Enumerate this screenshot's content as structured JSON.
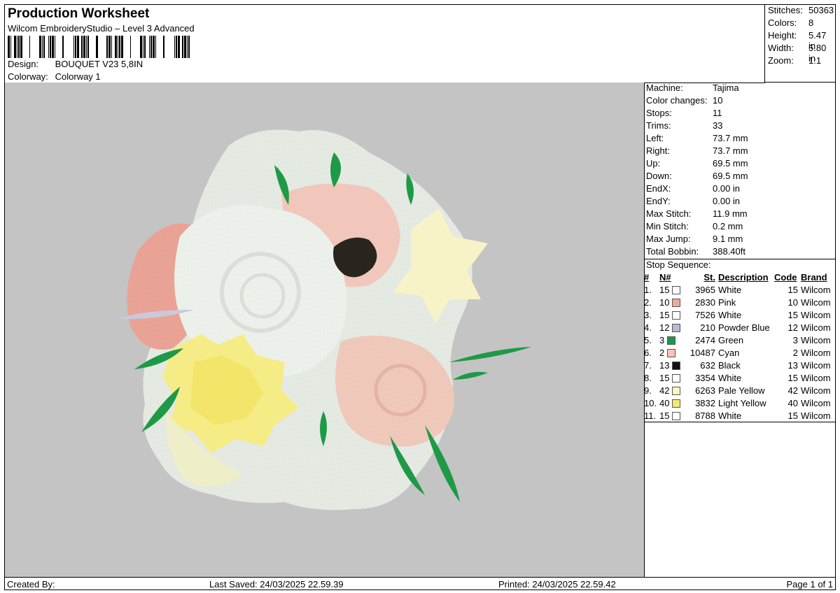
{
  "header": {
    "title": "Production Worksheet",
    "subtitle": "Wilcom EmbroideryStudio – Level 3 Advanced",
    "design_label": "Design:",
    "design_value": "BOUQUET V23 5,8IN",
    "colorway_label": "Colorway:",
    "colorway_value": "Colorway 1"
  },
  "summary": [
    {
      "label": "Stitches:",
      "value": "50363"
    },
    {
      "label": "Colors:",
      "value": "8"
    },
    {
      "label": "Height:",
      "value": "5.47 in"
    },
    {
      "label": "Width:",
      "value": "5.80 in"
    },
    {
      "label": "Zoom:",
      "value": "1:1"
    }
  ],
  "machine_info": [
    {
      "label": "Machine:",
      "value": "Tajima"
    },
    {
      "label": "Color changes:",
      "value": "10"
    },
    {
      "label": "Stops:",
      "value": "11"
    },
    {
      "label": "Trims:",
      "value": "33"
    },
    {
      "label": "Left:",
      "value": "73.7 mm"
    },
    {
      "label": "Right:",
      "value": "73.7 mm"
    },
    {
      "label": "Up:",
      "value": "69.5 mm"
    },
    {
      "label": "Down:",
      "value": "69.5 mm"
    },
    {
      "label": "EndX:",
      "value": "0.00 in"
    },
    {
      "label": "EndY:",
      "value": "0.00 in"
    },
    {
      "label": "Max Stitch:",
      "value": "11.9 mm"
    },
    {
      "label": "Min Stitch:",
      "value": "0.2 mm"
    },
    {
      "label": "Max Jump:",
      "value": "9.1 mm"
    },
    {
      "label": "Total Bobbin:",
      "value": "388.40ft"
    }
  ],
  "stop_sequence": {
    "title": "Stop Sequence:",
    "columns": [
      "#",
      "N#",
      "St.",
      "Description",
      "Code",
      "Brand"
    ],
    "rows": [
      {
        "idx": "1.",
        "n": "15",
        "color": "#ffffff",
        "st": "3965",
        "desc": "White",
        "code": "15",
        "brand": "Wilcom"
      },
      {
        "idx": "2.",
        "n": "10",
        "color": "#f2a79d",
        "st": "2830",
        "desc": "Pink",
        "code": "10",
        "brand": "Wilcom"
      },
      {
        "idx": "3.",
        "n": "15",
        "color": "#ffffff",
        "st": "7526",
        "desc": "White",
        "code": "15",
        "brand": "Wilcom"
      },
      {
        "idx": "4.",
        "n": "12",
        "color": "#b9b8d6",
        "st": "210",
        "desc": "Powder Blue",
        "code": "12",
        "brand": "Wilcom"
      },
      {
        "idx": "5.",
        "n": "3",
        "color": "#1a9a4c",
        "st": "2474",
        "desc": "Green",
        "code": "3",
        "brand": "Wilcom"
      },
      {
        "idx": "6.",
        "n": "2",
        "color": "#f7c3b8",
        "st": "10487",
        "desc": "Cyan",
        "code": "2",
        "brand": "Wilcom"
      },
      {
        "idx": "7.",
        "n": "13",
        "color": "#111111",
        "st": "632",
        "desc": "Black",
        "code": "13",
        "brand": "Wilcom"
      },
      {
        "idx": "8.",
        "n": "15",
        "color": "#ffffff",
        "st": "3354",
        "desc": "White",
        "code": "15",
        "brand": "Wilcom"
      },
      {
        "idx": "9.",
        "n": "42",
        "color": "#fbf5c2",
        "st": "6263",
        "desc": "Pale Yellow",
        "code": "42",
        "brand": "Wilcom"
      },
      {
        "idx": "10.",
        "n": "40",
        "color": "#f6e772",
        "st": "3832",
        "desc": "Light Yellow",
        "code": "40",
        "brand": "Wilcom"
      },
      {
        "idx": "11.",
        "n": "15",
        "color": "#ffffff",
        "st": "8788",
        "desc": "White",
        "code": "15",
        "brand": "Wilcom"
      }
    ]
  },
  "footer": {
    "created_by": "Created By:",
    "last_saved": "Last Saved: 24/03/2025 22.59.39",
    "printed": "Printed: 24/03/2025 22.59.42",
    "page": "Page 1 of 1"
  },
  "canvas": {
    "background": "#c4c4c4",
    "icon": "embroidery-bouquet-design"
  }
}
